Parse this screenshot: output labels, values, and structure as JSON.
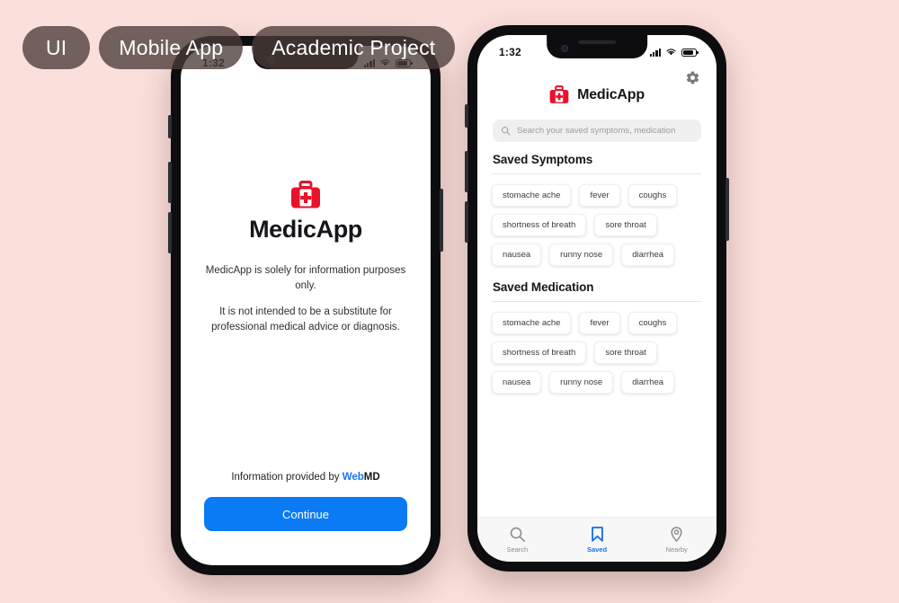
{
  "tags": [
    {
      "label": "UI"
    },
    {
      "label": "Mobile App"
    },
    {
      "label": "Academic Project"
    }
  ],
  "colors": {
    "background": "#fadfda",
    "brand_red": "#e8122a",
    "accent_blue": "#0b7bf5",
    "link_blue": "#1a73e8",
    "chip_text": "#3a3d42",
    "pill_bg": "#4a3c39"
  },
  "phone1": {
    "statusbar": {
      "time": "1:32",
      "signal_icon": "signal-bars-icon",
      "wifi_icon": "wifi-icon",
      "battery_icon": "battery-icon"
    },
    "logo_icon": "medical-kit-icon",
    "brand_title": "MedicApp",
    "disclaimer": [
      "MedicApp is solely for information purposes only.",
      "It is not intended to be a substitute for professional medical advice or diagnosis."
    ],
    "provided_prefix": "Information provided by ",
    "provided_brand_first": "Web",
    "provided_brand_second": "MD",
    "continue_label": "Continue"
  },
  "phone2": {
    "statusbar": {
      "time": "1:32",
      "signal_icon": "signal-bars-icon",
      "wifi_icon": "wifi-icon",
      "battery_icon": "battery-icon"
    },
    "settings_icon": "gear-icon",
    "logo_icon": "medical-kit-icon",
    "app_name": "MedicApp",
    "search": {
      "icon": "search-icon",
      "placeholder": "Search your saved symptoms, medication",
      "value": ""
    },
    "sections": [
      {
        "title": "Saved Symptoms",
        "chips": [
          "stomache ache",
          "fever",
          "coughs",
          "shortness of breath",
          "sore throat",
          "nausea",
          "runny nose",
          "diarrhea"
        ]
      },
      {
        "title": "Saved Medication",
        "chips": [
          "stomache ache",
          "fever",
          "coughs",
          "shortness of breath",
          "sore throat",
          "nausea",
          "runny nose",
          "diarrhea"
        ]
      }
    ],
    "bottom_nav": [
      {
        "label": "Search",
        "icon": "search-icon",
        "active": false
      },
      {
        "label": "Saved",
        "icon": "bookmark-icon",
        "active": true
      },
      {
        "label": "Nearby",
        "icon": "location-pin-icon",
        "active": false
      }
    ]
  }
}
